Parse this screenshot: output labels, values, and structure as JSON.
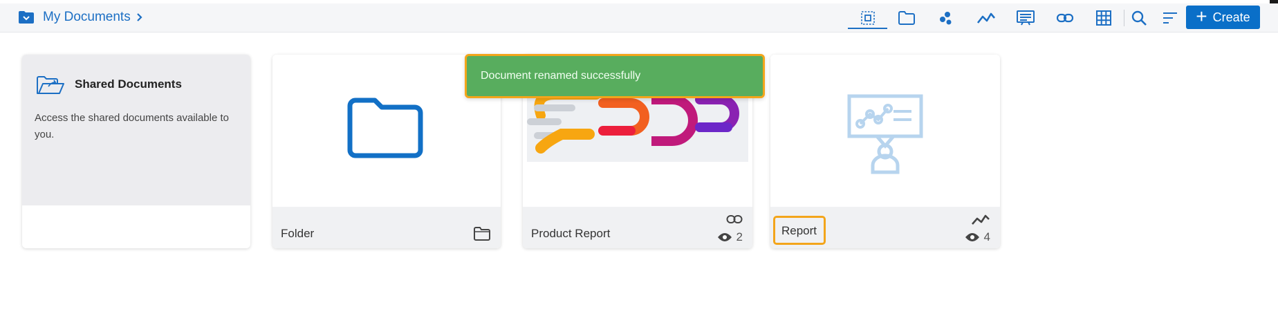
{
  "breadcrumb": {
    "label": "My Documents"
  },
  "toolbar": {
    "items": [
      {
        "name": "all-items-icon",
        "active": true
      },
      {
        "name": "folder-filter-icon"
      },
      {
        "name": "datasheet-icon"
      },
      {
        "name": "line-chart-icon"
      },
      {
        "name": "dashboard-icon"
      },
      {
        "name": "link-icon"
      },
      {
        "name": "table-grid-icon"
      },
      {
        "name": "search-icon"
      },
      {
        "name": "sort-icon"
      }
    ],
    "create_label": "Create"
  },
  "toast": {
    "message": "Document renamed successfully",
    "color": "#58ad5e"
  },
  "cards": {
    "shared": {
      "title": "Shared Documents",
      "description": "Access the shared documents available to you."
    },
    "folder": {
      "name": "Folder",
      "type_icon": "folder-icon"
    },
    "product": {
      "name": "Product Report",
      "type_icon": "link-icon",
      "views": "2"
    },
    "report": {
      "name": "Report",
      "type_icon": "line-chart-icon",
      "views": "4"
    }
  },
  "colors": {
    "accent": "#0a6fc8",
    "highlight": "#f3a51b"
  }
}
